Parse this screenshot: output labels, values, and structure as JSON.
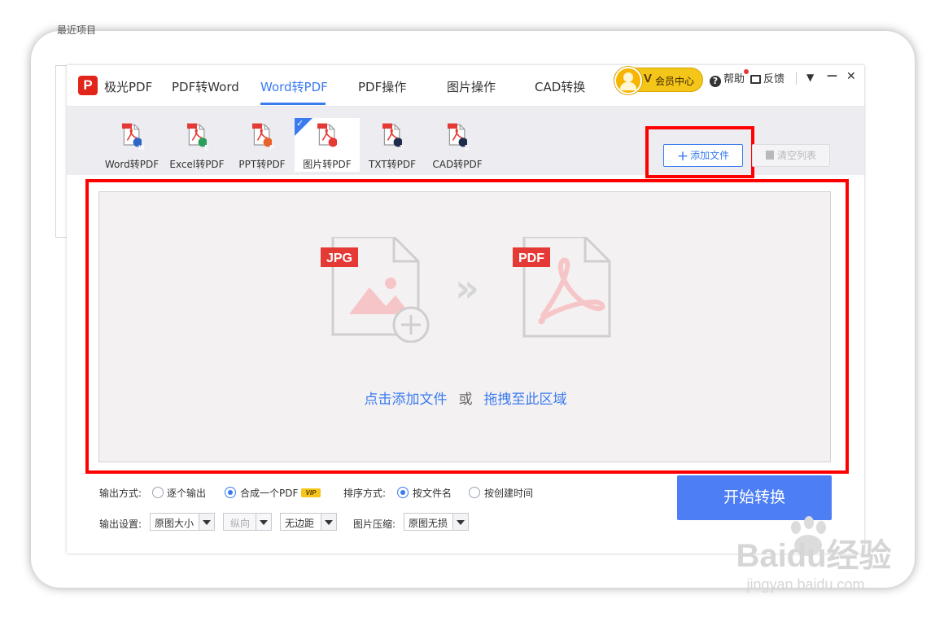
{
  "background": {
    "recent_label": "最近项目"
  },
  "app": {
    "name": "极光PDF",
    "main_tabs": [
      {
        "label": "PDF转Word"
      },
      {
        "label": "Word转PDF",
        "active": true
      },
      {
        "label": "PDF操作"
      },
      {
        "label": "图片操作"
      },
      {
        "label": "CAD转换"
      }
    ],
    "vip": {
      "v": "V",
      "label": "会员中心"
    },
    "help": "帮助",
    "feedback": "反馈",
    "window_controls": {
      "menu": "▼",
      "minimize": "—",
      "close": "✕"
    }
  },
  "sub_tabs": [
    {
      "label": "Word转PDF",
      "badge": "W",
      "color": "#2f66c6"
    },
    {
      "label": "Excel转PDF",
      "badge": "E",
      "color": "#2e9e5b"
    },
    {
      "label": "PPT转PDF",
      "badge": "P",
      "color": "#e8622a"
    },
    {
      "label": "图片转PDF",
      "badge": "▲",
      "color": "#e53935",
      "active": true
    },
    {
      "label": "TXT转PDF",
      "badge": "T",
      "color": "#1f2d4d"
    },
    {
      "label": "CAD转PDF",
      "badge": "D",
      "color": "#1f2d4d"
    }
  ],
  "toolbar": {
    "add_file": "添加文件",
    "clear_list": "清空列表"
  },
  "drop_zone": {
    "src_tag": "JPG",
    "dst_tag": "PDF",
    "arrow": "»",
    "add_link": "点击添加文件",
    "or": "或",
    "drag_link": "拖拽至此区域"
  },
  "options": {
    "output_mode_label": "输出方式:",
    "output_modes": [
      {
        "label": "逐个输出",
        "selected": false
      },
      {
        "label": "合成一个PDF",
        "selected": true
      }
    ],
    "vip_tag": "VIP",
    "sort_label": "排序方式:",
    "sort_modes": [
      {
        "label": "按文件名",
        "selected": true
      },
      {
        "label": "按创建时间",
        "selected": false
      }
    ],
    "output_settings_label": "输出设置:",
    "size_value": "原图大小",
    "orientation_value": "纵向",
    "margin_value": "无边距",
    "compress_label": "图片压缩:",
    "compress_value": "原图无损"
  },
  "start_button": "开始转换",
  "watermark": {
    "brand": "Baidu经验",
    "url": "jingyan.baidu.com"
  },
  "colors": {
    "accent": "#3a7bef",
    "highlight": "#ff0000",
    "brand_red": "#e1251b",
    "vip_gold": "#f5c61a"
  }
}
